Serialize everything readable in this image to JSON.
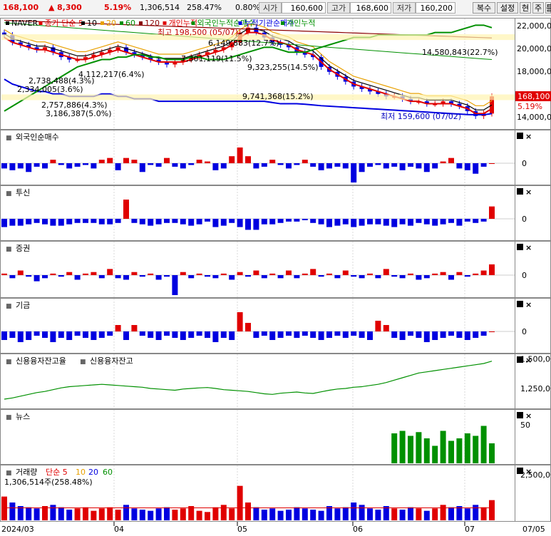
{
  "header": {
    "price": "168,100",
    "change_arrow": "▲",
    "change": "8,300",
    "change_pct": "5.19%",
    "volume": "1,306,514",
    "volume_ratio": "258.47%",
    "rate": "0.80%",
    "open_label": "시가",
    "open_value": "160,600",
    "high_label": "고가",
    "high_value": "168,600",
    "low_label": "저가",
    "low_value": "160,200",
    "buttons": [
      "복수",
      "설정",
      "현",
      "주",
      "틀"
    ]
  },
  "colors": {
    "up": "#e00000",
    "down": "#0000e0",
    "green": "#009000",
    "grid": "#d8d8d8"
  },
  "panel_icons": [
    "L-icon",
    "close-icon"
  ],
  "main_panel": {
    "legend": [
      {
        "text": "NAVER",
        "color": "#000000"
      },
      {
        "text": "종가 단순 5",
        "color": "#e00000"
      },
      {
        "text": "10",
        "color": "#000000"
      },
      {
        "text": "20",
        "color": "#e8a000"
      },
      {
        "text": "60",
        "color": "#009000"
      },
      {
        "text": "120",
        "color": "#8b0000"
      },
      {
        "text": "개인누적",
        "color": "#e00000"
      },
      {
        "text": "외국인누적순매수",
        "color": "#009000"
      },
      {
        "text": "누적기관순매수",
        "color": "#0000e0"
      },
      {
        "text": "개인누적",
        "color": "#009000"
      }
    ],
    "annotations": [
      {
        "text": "최고 198,500 (05/07)",
        "color": "#c00000"
      },
      {
        "text": "6,149,883(12.7%)",
        "color": "#000000"
      },
      {
        "text": "14,580,843(22.7%)",
        "color": "#000000"
      },
      {
        "text": "7,301,119(11.5%)",
        "color": "#000000"
      },
      {
        "text": "4,112,217(6.4%)",
        "color": "#000000"
      },
      {
        "text": "9,323,255(14.5%)",
        "color": "#000000"
      },
      {
        "text": "2,738,488(4.3%)",
        "color": "#000000"
      },
      {
        "text": "2,334,005(3.6%)",
        "color": "#000000"
      },
      {
        "text": "9,741,368(15.2%)",
        "color": "#000000"
      },
      {
        "text": "2,757,886(4.3%)",
        "color": "#000000"
      },
      {
        "text": "3,186,387(5.0%)",
        "color": "#000000"
      },
      {
        "text": "최저 159,600 (07/02)",
        "color": "#0000c0"
      }
    ],
    "axis_labels": [
      "22,000,0",
      "20,000,0",
      "18,000,0",
      "16,000,0",
      "14,000,0"
    ],
    "price_tag": "168,100",
    "pct_tag": "5.19%"
  },
  "sub_panels": [
    {
      "title": "외국인순매수",
      "axis": [
        "0"
      ]
    },
    {
      "title": "투신",
      "axis": [
        "0"
      ]
    },
    {
      "title": "증권",
      "axis": [
        "0"
      ]
    },
    {
      "title": "기금",
      "axis": [
        "0"
      ]
    },
    {
      "title": "신용융자잔고율",
      "title2": "신용융자잔고",
      "axis": [
        "1,500,00",
        "1,250,00"
      ]
    },
    {
      "title": "뉴스",
      "axis": [
        "50"
      ]
    },
    {
      "title": "거래량",
      "title2": "단순 5",
      "t3": "10",
      "t4": "20",
      "t5": "60",
      "sub_label": "1,306,514주(258.48%)",
      "axis": [
        "2,500,00"
      ]
    }
  ],
  "x_axis": [
    "2024/03",
    "04",
    "05",
    "06",
    "07",
    "07/05"
  ],
  "chart_data": [
    {
      "type": "line",
      "title": "NAVER",
      "note": "candlestick price with moving averages and cumulative investor lines",
      "price_high": 198500,
      "price_low": 159600,
      "last_close": 168100,
      "series": [
        {
          "name": "NAVER",
          "values": [
            193,
            190,
            189,
            188,
            187,
            188,
            186,
            184,
            183,
            183,
            184,
            185,
            186,
            187,
            188,
            186,
            185,
            184,
            183,
            182,
            181,
            182,
            183,
            184,
            185,
            186,
            187,
            188,
            190,
            194,
            196,
            194,
            192,
            190,
            189,
            188,
            186,
            185,
            184,
            180,
            178,
            176,
            174,
            172,
            171,
            170,
            169,
            168,
            168,
            167,
            166,
            166,
            165,
            165,
            166,
            165,
            164,
            162,
            160,
            161,
            168
          ]
        },
        {
          "name": "종가 단순 5",
          "values": [
            192,
            190,
            189,
            188,
            187,
            187,
            186,
            185,
            184,
            183,
            183,
            184,
            185,
            186,
            187,
            186,
            185,
            184,
            183,
            182,
            182,
            182,
            182,
            183,
            184,
            185,
            186,
            187,
            189,
            192,
            194,
            194,
            193,
            191,
            190,
            189,
            187,
            186,
            185,
            182,
            179,
            177,
            175,
            173,
            172,
            171,
            170,
            169,
            168,
            167,
            166,
            166,
            165,
            165,
            165,
            165,
            164,
            163,
            161,
            161,
            163
          ]
        }
      ]
    },
    {
      "type": "bar",
      "title": "외국인순매수",
      "values": [
        -3,
        -4,
        -3,
        -5,
        -2,
        -3,
        2,
        -1,
        -3,
        -2,
        -1,
        -3,
        2,
        3,
        -4,
        3,
        2,
        -5,
        -1,
        -2,
        3,
        -2,
        -3,
        -1,
        2,
        1,
        -4,
        -3,
        4,
        9,
        4,
        -3,
        -2,
        2,
        -1,
        -3,
        -1,
        2,
        -2,
        -4,
        -3,
        -2,
        -3,
        -11,
        -5,
        -2,
        -1,
        -3,
        -2,
        -4,
        -2,
        -3,
        -5,
        -3,
        1,
        3,
        -3,
        -4,
        -6,
        -2,
        0
      ]
    },
    {
      "type": "bar",
      "title": "투신",
      "values": [
        -6,
        -5,
        -5,
        -4,
        -3,
        -4,
        -5,
        -5,
        -4,
        -3,
        -3,
        -3,
        -4,
        -4,
        -3,
        14,
        -3,
        -4,
        -5,
        -4,
        -3,
        -3,
        -4,
        -5,
        -4,
        -2,
        -6,
        -5,
        -3,
        -6,
        -8,
        -8,
        -4,
        -4,
        -3,
        -2,
        -2,
        -1,
        -3,
        -4,
        -6,
        -5,
        -4,
        -6,
        -5,
        -4,
        -4,
        -5,
        -6,
        -4,
        -5,
        -3,
        -4,
        -5,
        -4,
        -3,
        -5,
        -2,
        -3,
        -2,
        9
      ]
    },
    {
      "type": "bar",
      "title": "증권",
      "values": [
        1,
        -2,
        3,
        -1,
        -4,
        -2,
        1,
        -1,
        2,
        -3,
        1,
        2,
        -2,
        4,
        -2,
        -3,
        2,
        -1,
        1,
        -3,
        -1,
        -13,
        2,
        -2,
        1,
        -1,
        -2,
        1,
        -3,
        2,
        -1,
        3,
        -2,
        1,
        -2,
        3,
        -2,
        1,
        4,
        -1,
        1,
        -2,
        3,
        -1,
        -2,
        1,
        -2,
        4,
        -1,
        -2,
        1,
        -3,
        -2,
        1,
        2,
        -3,
        2,
        -1,
        1,
        3,
        7
      ]
    },
    {
      "type": "bar",
      "title": "기금",
      "values": [
        -4,
        -3,
        -5,
        -4,
        -2,
        -3,
        -5,
        -3,
        -4,
        -2,
        -3,
        -4,
        -3,
        -2,
        3,
        -4,
        3,
        -2,
        -3,
        -4,
        -2,
        -3,
        -4,
        -3,
        -2,
        -3,
        -5,
        -3,
        -4,
        9,
        4,
        -3,
        -2,
        -4,
        -3,
        -2,
        -3,
        -2,
        -3,
        -4,
        -3,
        -2,
        -3,
        -2,
        -3,
        -4,
        5,
        3,
        -3,
        -4,
        -2,
        -3,
        -5,
        -4,
        -3,
        -2,
        -3,
        -4,
        -3,
        -2,
        0
      ]
    },
    {
      "type": "line",
      "title": "신용융자잔고율",
      "values": [
        1160,
        1170,
        1185,
        1200,
        1215,
        1225,
        1240,
        1255,
        1265,
        1270,
        1275,
        1280,
        1285,
        1280,
        1275,
        1270,
        1265,
        1260,
        1250,
        1245,
        1240,
        1235,
        1245,
        1250,
        1255,
        1258,
        1250,
        1240,
        1235,
        1230,
        1225,
        1215,
        1205,
        1200,
        1210,
        1215,
        1220,
        1212,
        1208,
        1222,
        1235,
        1245,
        1250,
        1260,
        1265,
        1275,
        1285,
        1300,
        1320,
        1340,
        1360,
        1380,
        1390,
        1400,
        1410,
        1420,
        1430,
        1440,
        1450,
        1460,
        1480
      ]
    },
    {
      "type": "bar",
      "title": "뉴스",
      "values": [
        0,
        0,
        0,
        0,
        0,
        0,
        0,
        0,
        0,
        0,
        0,
        0,
        0,
        0,
        0,
        0,
        0,
        0,
        0,
        0,
        0,
        0,
        0,
        0,
        0,
        0,
        0,
        0,
        0,
        0,
        0,
        0,
        0,
        0,
        0,
        0,
        0,
        0,
        0,
        0,
        0,
        0,
        0,
        0,
        0,
        0,
        0,
        0,
        24,
        26,
        22,
        25,
        20,
        14,
        26,
        18,
        20,
        24,
        22,
        30,
        16
      ]
    },
    {
      "type": "bar",
      "title": "거래량",
      "values": [
        2,
        1.5,
        1.2,
        1.1,
        1,
        1.2,
        1.3,
        1.1,
        0.9,
        1,
        1.1,
        0.8,
        1,
        1.1,
        0.9,
        1.3,
        1,
        0.9,
        0.8,
        1,
        1.1,
        0.9,
        1,
        1.2,
        0.8,
        0.7,
        1.1,
        1.3,
        1,
        2.9,
        1.5,
        1.1,
        0.9,
        1,
        0.8,
        0.9,
        1.1,
        1,
        0.9,
        0.8,
        1.2,
        1,
        1.1,
        1.5,
        1.3,
        1,
        0.9,
        1.2,
        1,
        0.9,
        1.1,
        1,
        0.8,
        1,
        1.3,
        1.1,
        1.2,
        1,
        1.3,
        1.1,
        1.7
      ]
    }
  ]
}
